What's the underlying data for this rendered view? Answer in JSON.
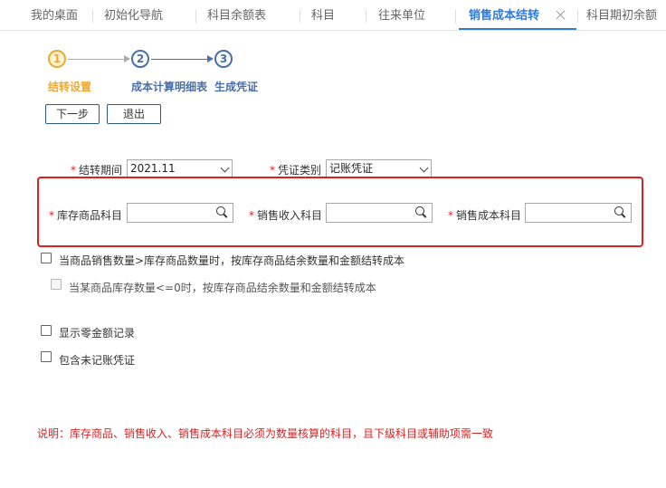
{
  "tabs": [
    {
      "label": "我的桌面"
    },
    {
      "label": "初始化导航"
    },
    {
      "label": "科目余额表"
    },
    {
      "label": "科目"
    },
    {
      "label": "往来单位"
    },
    {
      "label": "销售成本结转",
      "active": true
    },
    {
      "label": "科目期初余额"
    }
  ],
  "stepper": {
    "steps": [
      {
        "number": "1",
        "label": "结转设置",
        "state": "current"
      },
      {
        "number": "2",
        "label": "成本计算明细表",
        "state": "pending"
      },
      {
        "number": "3",
        "label": "生成凭证",
        "state": "pending"
      }
    ]
  },
  "buttons": {
    "next": "下一步",
    "exit": "退出"
  },
  "form": {
    "required_mark": "*",
    "period": {
      "label": "结转期间",
      "value": "2021.11"
    },
    "voucher_type": {
      "label": "凭证类别",
      "value": "记账凭证"
    },
    "inventory_account": {
      "label": "库存商品科目",
      "value": ""
    },
    "sales_income_account": {
      "label": "销售收入科目",
      "value": ""
    },
    "sales_cost_account": {
      "label": "销售成本科目",
      "value": ""
    }
  },
  "options": [
    {
      "label": "当商品销售数量>库存商品数量时，按库存商品结余数量和金额结转成本",
      "checked": false,
      "enabled": true
    },
    {
      "label": "当某商品库存数量<=0时，按库存商品结余数量和金额结转成本",
      "checked": false,
      "enabled": false
    },
    {
      "label": "显示零金额记录",
      "checked": false,
      "enabled": true
    },
    {
      "label": "包含未记账凭证",
      "checked": false,
      "enabled": true
    }
  ],
  "note": "说明：库存商品、销售收入、销售成本科目必须为数量核算的科目，且下级科目或辅助项需一致",
  "colors": {
    "accent": "#2f7bd9",
    "step_current": "#f0a830",
    "step_pending": "#4a6fa5",
    "required": "#e02020",
    "highlight_border": "#e02020"
  }
}
